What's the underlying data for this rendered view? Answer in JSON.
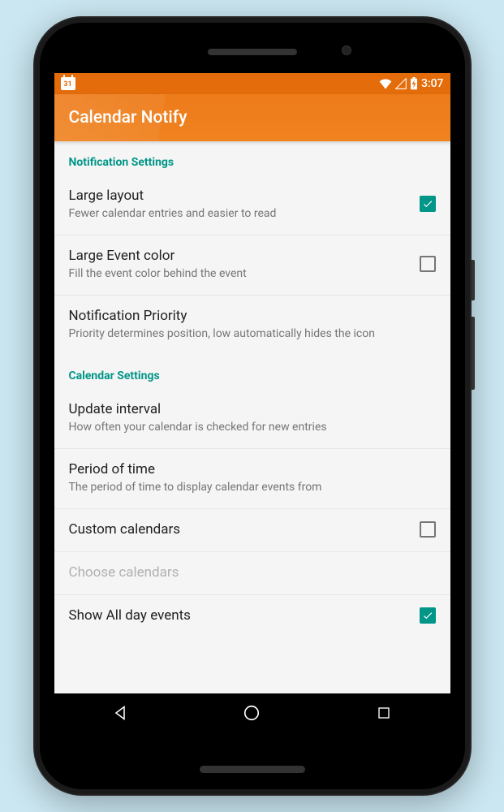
{
  "status": {
    "cal_icon_day": "31",
    "time": "3:07"
  },
  "app": {
    "title": "Calendar Notify"
  },
  "sections": [
    {
      "header": "Notification Settings",
      "items": [
        {
          "title": "Large layout",
          "sub": "Fewer calendar entries and easier to read",
          "checkbox": true,
          "checked": true
        },
        {
          "title": "Large Event color",
          "sub": "Fill the event color behind the event",
          "checkbox": true,
          "checked": false
        },
        {
          "title": "Notification Priority",
          "sub": "Priority determines position, low automatically hides the icon",
          "checkbox": false
        }
      ]
    },
    {
      "header": "Calendar Settings",
      "items": [
        {
          "title": "Update interval",
          "sub": "How often your calendar is checked for new entries",
          "checkbox": false
        },
        {
          "title": "Period of time",
          "sub": "The period of time to display calendar events from",
          "checkbox": false
        },
        {
          "title": "Custom calendars",
          "sub": "",
          "checkbox": true,
          "checked": false
        },
        {
          "title": "Choose calendars",
          "sub": "",
          "checkbox": false,
          "disabled": true
        },
        {
          "title": "Show All day events",
          "sub": "",
          "checkbox": true,
          "checked": true
        }
      ]
    }
  ]
}
